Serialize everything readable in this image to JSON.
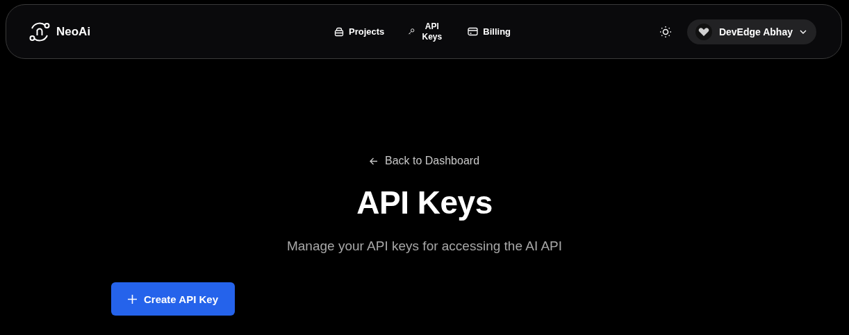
{
  "header": {
    "brand": "NeoAi",
    "nav": [
      {
        "label": "Projects",
        "kind": "projects"
      },
      {
        "label": "API Keys",
        "kind": "keys"
      },
      {
        "label": "Billing",
        "kind": "billing"
      }
    ],
    "user": {
      "name": "DevEdge Abhay"
    }
  },
  "back_link": "Back to Dashboard",
  "title": "API Keys",
  "subtitle": "Manage your API keys for accessing the AI API",
  "create_button": {
    "label": "Create API Key"
  }
}
